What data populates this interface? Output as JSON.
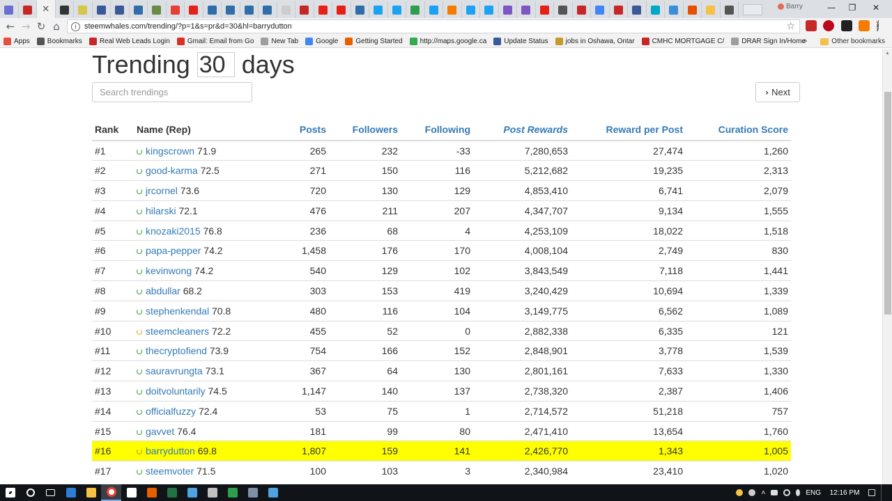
{
  "browser": {
    "profile_name": "Barry",
    "window_controls": {
      "minimize": "—",
      "restore": "❐",
      "close": "✕"
    },
    "url": "steemwhales.com/trending/?p=1&s=pr&d=30&hl=barrydutton",
    "tab_favicon_colors": [
      "#6b6fd1",
      "#c62828",
      "#ffffff",
      "#333333",
      "#d4c74a",
      "#3b5998",
      "#3b5998",
      "#2f6ea8",
      "#6a8a45",
      "#e44134",
      "#e62117",
      "#2f6ea8",
      "#2f6ea8",
      "#2f6ea8",
      "#2f6ea8",
      "#cccccc",
      "#c62828",
      "#e62117",
      "#e62117",
      "#2f6ea8",
      "#1da1f2",
      "#1da1f2",
      "#2e9e4d",
      "#1da1f2",
      "#f57c00",
      "#1da1f2",
      "#1da1f2",
      "#7e57c2",
      "#7e57c2",
      "#e62117",
      "#555555",
      "#c62828",
      "#4285f4",
      "#c62828",
      "#3b5998",
      "#00a8c6",
      "#3a8fd8",
      "#e65100",
      "#f5c244",
      "#555555"
    ],
    "bookmarks": [
      {
        "label": "Apps",
        "icon": "apps-grid-icon",
        "color": "#e25040"
      },
      {
        "label": "Bookmarks",
        "icon": "star-icon",
        "color": "#555555"
      },
      {
        "label": "Real Web Leads Login",
        "icon": "leads-icon",
        "color": "#c62828"
      },
      {
        "label": "Gmail: Email from Go",
        "icon": "gmail-icon",
        "color": "#d93025"
      },
      {
        "label": "New Tab",
        "icon": "page-icon",
        "color": "#9e9e9e"
      },
      {
        "label": "Google",
        "icon": "google-icon",
        "color": "#4285f4"
      },
      {
        "label": "Getting Started",
        "icon": "firefox-icon",
        "color": "#e66000"
      },
      {
        "label": "http://maps.google.ca",
        "icon": "maps-icon",
        "color": "#34a853"
      },
      {
        "label": "Update Status",
        "icon": "facebook-icon",
        "color": "#3b5998"
      },
      {
        "label": "jobs in Oshawa, Ontar",
        "icon": "e-icon",
        "color": "#c49a2c"
      },
      {
        "label": "CMHC MORTGAGE C/",
        "icon": "cmhc-icon",
        "color": "#c62828"
      },
      {
        "label": "DRAR Sign In/Home",
        "icon": "page-icon",
        "color": "#9e9e9e"
      }
    ],
    "bookmarks_more": "»",
    "other_bookmarks": "Other bookmarks"
  },
  "page": {
    "title_prefix": "Trending",
    "days_value": "30",
    "title_suffix": "days",
    "search_placeholder": "Search trendings",
    "next_label": "Next"
  },
  "table": {
    "headers": {
      "rank": "Rank",
      "name": "Name (Rep)",
      "posts": "Posts",
      "followers": "Followers",
      "following": "Following",
      "post_rewards": "Post Rewards",
      "reward_per_post": "Reward per Post",
      "curation_score": "Curation Score"
    },
    "rows": [
      {
        "rank": "#1",
        "name": "kingscrown",
        "rep": "71.9",
        "posts": "265",
        "followers": "232",
        "following": "-33",
        "rewards": "7,280,653",
        "per_post": "27,474",
        "curation": "1,260",
        "status": "green"
      },
      {
        "rank": "#2",
        "name": "good-karma",
        "rep": "72.5",
        "posts": "271",
        "followers": "150",
        "following": "116",
        "rewards": "5,212,682",
        "per_post": "19,235",
        "curation": "2,313",
        "status": "green"
      },
      {
        "rank": "#3",
        "name": "jrcornel",
        "rep": "73.6",
        "posts": "720",
        "followers": "130",
        "following": "129",
        "rewards": "4,853,410",
        "per_post": "6,741",
        "curation": "2,079",
        "status": "green"
      },
      {
        "rank": "#4",
        "name": "hilarski",
        "rep": "72.1",
        "posts": "476",
        "followers": "211",
        "following": "207",
        "rewards": "4,347,707",
        "per_post": "9,134",
        "curation": "1,555",
        "status": "green"
      },
      {
        "rank": "#5",
        "name": "knozaki2015",
        "rep": "76.8",
        "posts": "236",
        "followers": "68",
        "following": "4",
        "rewards": "4,253,109",
        "per_post": "18,022",
        "curation": "1,518",
        "status": "green"
      },
      {
        "rank": "#6",
        "name": "papa-pepper",
        "rep": "74.2",
        "posts": "1,458",
        "followers": "176",
        "following": "170",
        "rewards": "4,008,104",
        "per_post": "2,749",
        "curation": "830",
        "status": "green"
      },
      {
        "rank": "#7",
        "name": "kevinwong",
        "rep": "74.2",
        "posts": "540",
        "followers": "129",
        "following": "102",
        "rewards": "3,843,549",
        "per_post": "7,118",
        "curation": "1,441",
        "status": "green"
      },
      {
        "rank": "#8",
        "name": "abdullar",
        "rep": "68.2",
        "posts": "303",
        "followers": "153",
        "following": "419",
        "rewards": "3,240,429",
        "per_post": "10,694",
        "curation": "1,339",
        "status": "green"
      },
      {
        "rank": "#9",
        "name": "stephenkendal",
        "rep": "70.8",
        "posts": "480",
        "followers": "116",
        "following": "104",
        "rewards": "3,149,775",
        "per_post": "6,562",
        "curation": "1,089",
        "status": "green"
      },
      {
        "rank": "#10",
        "name": "steemcleaners",
        "rep": "72.2",
        "posts": "455",
        "followers": "52",
        "following": "0",
        "rewards": "2,882,338",
        "per_post": "6,335",
        "curation": "121",
        "status": "orange"
      },
      {
        "rank": "#11",
        "name": "thecryptofiend",
        "rep": "73.9",
        "posts": "754",
        "followers": "166",
        "following": "152",
        "rewards": "2,848,901",
        "per_post": "3,778",
        "curation": "1,539",
        "status": "green"
      },
      {
        "rank": "#12",
        "name": "sauravrungta",
        "rep": "73.1",
        "posts": "367",
        "followers": "64",
        "following": "130",
        "rewards": "2,801,161",
        "per_post": "7,633",
        "curation": "1,330",
        "status": "green"
      },
      {
        "rank": "#13",
        "name": "doitvoluntarily",
        "rep": "74.5",
        "posts": "1,147",
        "followers": "140",
        "following": "137",
        "rewards": "2,738,320",
        "per_post": "2,387",
        "curation": "1,406",
        "status": "green"
      },
      {
        "rank": "#14",
        "name": "officialfuzzy",
        "rep": "72.4",
        "posts": "53",
        "followers": "75",
        "following": "1",
        "rewards": "2,714,572",
        "per_post": "51,218",
        "curation": "757",
        "status": "green"
      },
      {
        "rank": "#15",
        "name": "gavvet",
        "rep": "76.4",
        "posts": "181",
        "followers": "99",
        "following": "80",
        "rewards": "2,471,410",
        "per_post": "13,654",
        "curation": "1,760",
        "status": "green"
      },
      {
        "rank": "#16",
        "name": "barrydutton",
        "rep": "69.8",
        "posts": "1,807",
        "followers": "159",
        "following": "141",
        "rewards": "2,426,770",
        "per_post": "1,343",
        "curation": "1,005",
        "status": "orange",
        "highlighted": true
      },
      {
        "rank": "#17",
        "name": "steemvoter",
        "rep": "71.5",
        "posts": "100",
        "followers": "103",
        "following": "3",
        "rewards": "2,340,984",
        "per_post": "23,410",
        "curation": "1,020",
        "status": "green"
      }
    ],
    "highlight_color": "#ffff00",
    "link_color": "#337ab7"
  },
  "taskbar": {
    "icons": [
      {
        "name": "windows-start-icon",
        "color": "#ffffff"
      },
      {
        "name": "cortana-search-icon",
        "color": "#ffffff"
      },
      {
        "name": "task-view-icon",
        "color": "#ffffff"
      },
      {
        "name": "edge-icon",
        "color": "#2d7dd2"
      },
      {
        "name": "file-explorer-icon",
        "color": "#f5c244"
      },
      {
        "name": "chrome-icon",
        "color": "#e94235",
        "active": true
      },
      {
        "name": "store-icon",
        "color": "#ffffff"
      },
      {
        "name": "firefox-icon",
        "color": "#e66000"
      },
      {
        "name": "excel-icon",
        "color": "#217346"
      },
      {
        "name": "app-icon",
        "color": "#4ea3e0"
      },
      {
        "name": "app-icon",
        "color": "#c0c0c0"
      },
      {
        "name": "app-icon",
        "color": "#2e9e4d"
      },
      {
        "name": "app-icon",
        "color": "#7f8fa6"
      },
      {
        "name": "app-icon",
        "color": "#4ea3e0"
      }
    ],
    "language": "ENG",
    "time": "12:16 PM"
  }
}
